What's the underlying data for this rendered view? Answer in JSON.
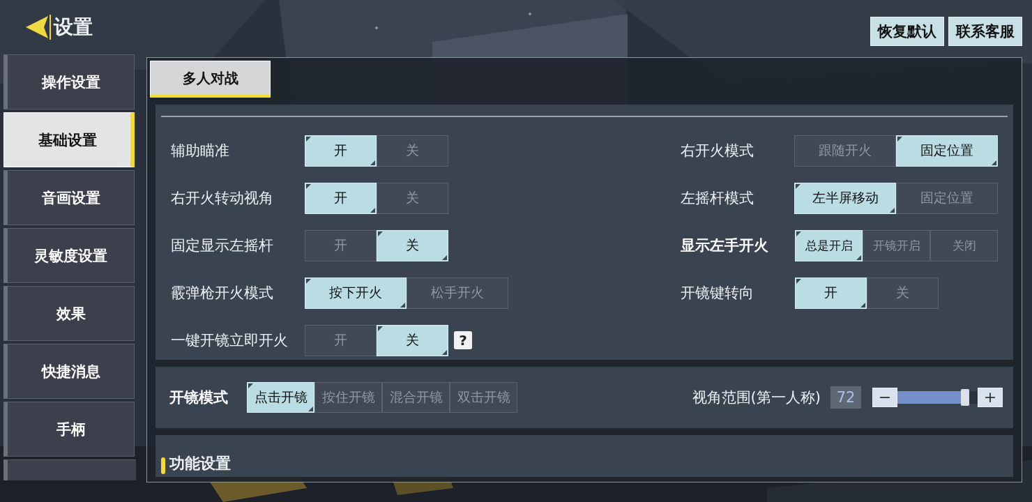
{
  "header": {
    "back_title": "设置"
  },
  "top_buttons": [
    "恢复默认",
    "联系客服"
  ],
  "sidebar": {
    "items": [
      {
        "label": "操作设置",
        "selected": false
      },
      {
        "label": "基础设置",
        "selected": true
      },
      {
        "label": "音画设置",
        "selected": false
      },
      {
        "label": "灵敏度设置",
        "selected": false
      },
      {
        "label": "效果",
        "selected": false
      },
      {
        "label": "快捷消息",
        "selected": false
      },
      {
        "label": "手柄",
        "selected": false
      }
    ]
  },
  "tabs": [
    {
      "label": "多人对战",
      "selected": true
    }
  ],
  "settings": {
    "left": [
      {
        "label": "辅助瞄准",
        "highlighted": false,
        "options": [
          {
            "label": "开",
            "selected": true
          },
          {
            "label": "关",
            "selected": false
          }
        ]
      },
      {
        "label": "右开火转动视角",
        "highlighted": false,
        "options": [
          {
            "label": "开",
            "selected": true
          },
          {
            "label": "关",
            "selected": false
          }
        ]
      },
      {
        "label": "固定显示左摇杆",
        "highlighted": false,
        "options": [
          {
            "label": "开",
            "selected": false
          },
          {
            "label": "关",
            "selected": true
          }
        ]
      },
      {
        "label": "霰弹枪开火模式",
        "highlighted": false,
        "options": [
          {
            "label": "按下开火",
            "selected": true
          },
          {
            "label": "松手开火",
            "selected": false
          }
        ]
      },
      {
        "label": "一键开镜立即开火",
        "highlighted": false,
        "help": "?",
        "options": [
          {
            "label": "开",
            "selected": false
          },
          {
            "label": "关",
            "selected": true
          }
        ]
      }
    ],
    "right": [
      {
        "label": "右开火模式",
        "highlighted": false,
        "options": [
          {
            "label": "跟随开火",
            "selected": false
          },
          {
            "label": "固定位置",
            "selected": true
          }
        ]
      },
      {
        "label": "左摇杆模式",
        "highlighted": false,
        "options": [
          {
            "label": "左半屏移动",
            "selected": true
          },
          {
            "label": "固定位置",
            "selected": false
          }
        ]
      },
      {
        "label": "显示左手开火",
        "highlighted": true,
        "options": [
          {
            "label": "总是开启",
            "selected": true
          },
          {
            "label": "开镜开启",
            "selected": false
          },
          {
            "label": "关闭",
            "selected": false
          }
        ]
      },
      {
        "label": "开镜键转向",
        "highlighted": false,
        "options": [
          {
            "label": "开",
            "selected": true
          },
          {
            "label": "关",
            "selected": false
          }
        ]
      }
    ]
  },
  "scope": {
    "label": "开镜模式",
    "options": [
      {
        "label": "点击开镜",
        "selected": true
      },
      {
        "label": "按住开镜",
        "selected": false
      },
      {
        "label": "混合开镜",
        "selected": false
      },
      {
        "label": "双击开镜",
        "selected": false
      }
    ],
    "fov": {
      "label": "视角范围(第一人称)",
      "reading": "72",
      "minus": "−",
      "plus": "+",
      "level": 0.84
    }
  },
  "section_title": "功能设置"
}
